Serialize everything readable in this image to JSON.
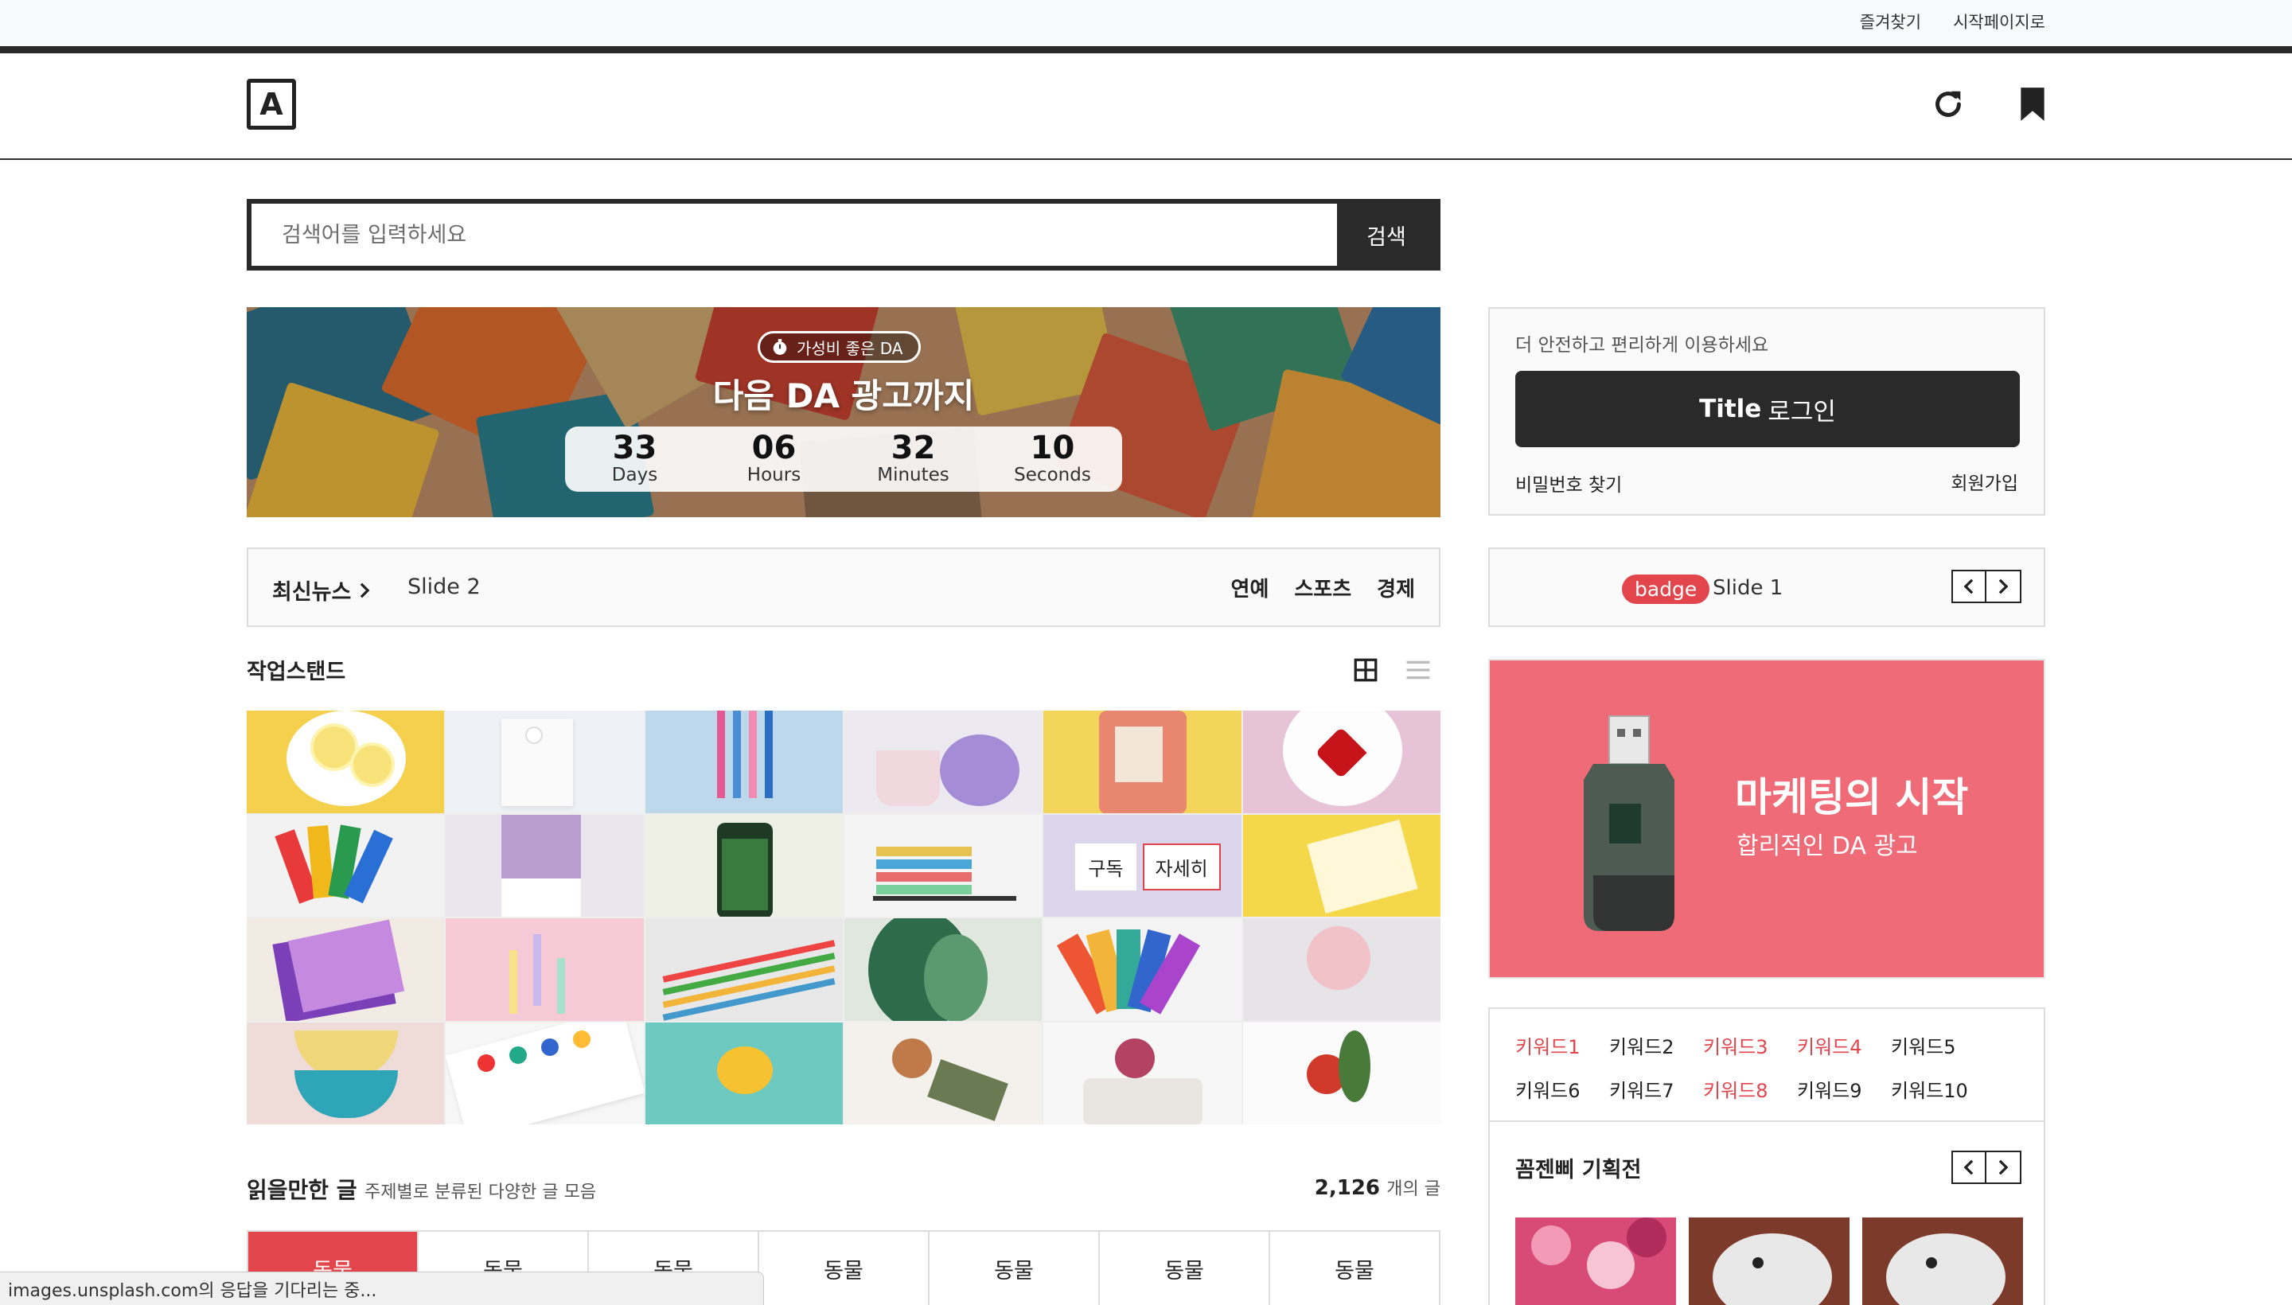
{
  "util_bar": {
    "favorites": "즐겨찾기",
    "start_page": "시작페이지로"
  },
  "header": {
    "logo": "A",
    "refresh_icon": "refresh-icon",
    "bookmark_icon": "bookmark-icon"
  },
  "search": {
    "placeholder": "검색어를 입력하세요",
    "button": "검색"
  },
  "banner": {
    "chip": "가성비 좋은 DA",
    "title": "다음 DA 광고까지",
    "countdown": [
      {
        "value": "33",
        "unit": "Days"
      },
      {
        "value": "06",
        "unit": "Hours"
      },
      {
        "value": "32",
        "unit": "Minutes"
      },
      {
        "value": "10",
        "unit": "Seconds"
      }
    ]
  },
  "news": {
    "title": "최신뉴스",
    "slide": "Slide 2",
    "categories": [
      "연예",
      "스포츠",
      "경제"
    ]
  },
  "workstand": {
    "title": "작업스탠드",
    "hover_buttons": [
      "구독",
      "자세히"
    ]
  },
  "readable": {
    "title": "읽을만한 글",
    "subtitle": "주제별로 분류된 다양한 글 모음",
    "count": "2,126",
    "count_suffix": "개의 글",
    "tabs": [
      "동물",
      "동물",
      "동물",
      "동물",
      "동물",
      "동물",
      "동물"
    ]
  },
  "status_bar": "images.unsplash.com의 응답을 기다리는 중...",
  "login": {
    "message": "더 안전하고 편리하게 이용하세요",
    "brand": "Title",
    "button": "로그인",
    "find_password": "비밀번호 찾기",
    "join": "회원가입"
  },
  "slide_box": {
    "badge": "badge",
    "label": "Slide 1"
  },
  "ad": {
    "title": "마케팅의 시작",
    "subtitle": "합리적인 DA 광고"
  },
  "keywords": [
    {
      "label": "키워드1",
      "hot": true
    },
    {
      "label": "키워드2",
      "hot": false
    },
    {
      "label": "키워드3",
      "hot": true
    },
    {
      "label": "키워드4",
      "hot": true
    },
    {
      "label": "키워드5",
      "hot": false
    },
    {
      "label": "키워드6",
      "hot": false
    },
    {
      "label": "키워드7",
      "hot": false
    },
    {
      "label": "키워드8",
      "hot": true
    },
    {
      "label": "키워드9",
      "hot": false
    },
    {
      "label": "키워드10",
      "hot": false
    }
  ],
  "plan": {
    "title": "꼼젠삐 기획전"
  },
  "colors": {
    "accent": "#e2454c",
    "dark": "#2a2a2a",
    "ad_bg": "#ee6b77"
  }
}
